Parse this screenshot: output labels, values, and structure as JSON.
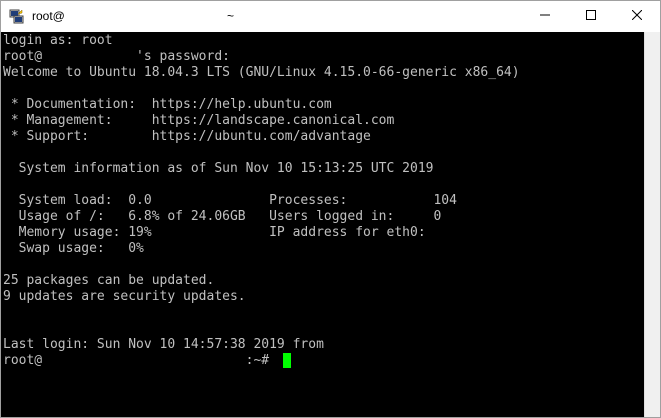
{
  "window": {
    "title_left": "root@",
    "title_center": "~",
    "minimize_glyph": "minimize-icon",
    "maximize_glyph": "maximize-icon",
    "close_glyph": "close-icon",
    "app_icon": "putty-icon"
  },
  "terminal": {
    "lines": [
      "login as: root",
      "root@            's password:",
      "Welcome to Ubuntu 18.04.3 LTS (GNU/Linux 4.15.0-66-generic x86_64)",
      "",
      " * Documentation:  https://help.ubuntu.com",
      " * Management:     https://landscape.canonical.com",
      " * Support:        https://ubuntu.com/advantage",
      "",
      "  System information as of Sun Nov 10 15:13:25 UTC 2019",
      "",
      "  System load:  0.0               Processes:           104",
      "  Usage of /:   6.8% of 24.06GB   Users logged in:     0",
      "  Memory usage: 19%               IP address for eth0:",
      "  Swap usage:   0%",
      "",
      "25 packages can be updated.",
      "9 updates are security updates.",
      "",
      "",
      "Last login: Sun Nov 10 14:57:38 2019 from",
      "root@                          :~# "
    ],
    "colors": {
      "background": "#000000",
      "foreground": "#c0c0c0",
      "cursor": "#00ff00"
    }
  }
}
